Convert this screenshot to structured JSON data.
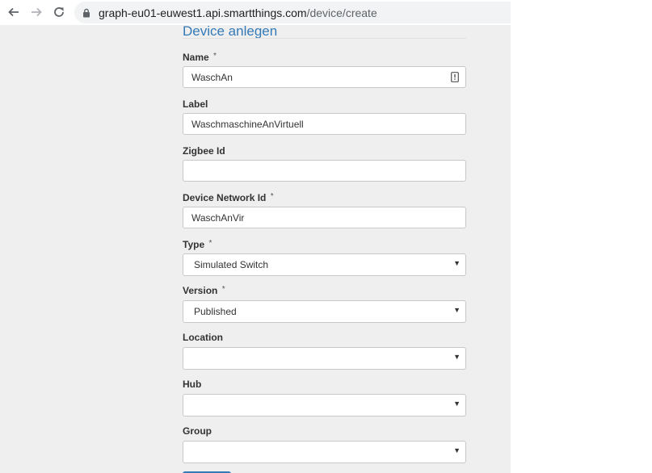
{
  "browser": {
    "url_host": "graph-eu01-euwest1.api.smartthings.com",
    "url_path": "/device/create"
  },
  "form": {
    "title": "Device anlegen",
    "required_mark": "*",
    "name": {
      "label": "Name",
      "value": "WaschAn"
    },
    "label": {
      "label": "Label",
      "value": "WaschmaschineAnVirtuell"
    },
    "zigbee": {
      "label": "Zigbee Id",
      "value": ""
    },
    "network": {
      "label": "Device Network Id",
      "value": "WaschAnVir"
    },
    "type": {
      "label": "Type",
      "value": "Simulated Switch"
    },
    "version": {
      "label": "Version",
      "value": "Published"
    },
    "location": {
      "label": "Location",
      "value": ""
    },
    "hub": {
      "label": "Hub",
      "value": ""
    },
    "group": {
      "label": "Group",
      "value": ""
    }
  },
  "colors": {
    "title": "#337ab7",
    "page_background": "#efefef",
    "primary_button": "#337ab7"
  },
  "icons": {
    "back": "arrow-left-icon",
    "forward": "arrow-right-icon",
    "reload": "reload-icon",
    "lock": "lock-icon",
    "autofill": "autofill-key-icon",
    "dropdown": "chevron-down-icon"
  }
}
